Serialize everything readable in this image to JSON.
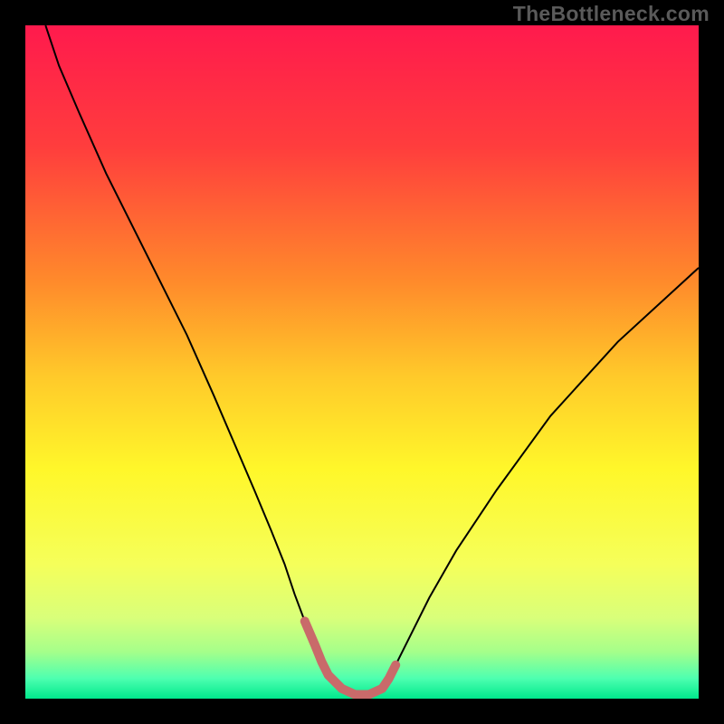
{
  "watermark": "TheBottleneck.com",
  "chart_data": {
    "type": "line",
    "title": "",
    "xlabel": "",
    "ylabel": "",
    "xlim": [
      0,
      100
    ],
    "ylim": [
      0,
      100
    ],
    "background_gradient_stops": [
      {
        "offset": 0.0,
        "color": "#ff1a4d"
      },
      {
        "offset": 0.18,
        "color": "#ff3d3d"
      },
      {
        "offset": 0.38,
        "color": "#ff8a2b"
      },
      {
        "offset": 0.52,
        "color": "#ffc92a"
      },
      {
        "offset": 0.66,
        "color": "#fff72a"
      },
      {
        "offset": 0.8,
        "color": "#f5ff5a"
      },
      {
        "offset": 0.88,
        "color": "#d9ff7a"
      },
      {
        "offset": 0.93,
        "color": "#a6ff8a"
      },
      {
        "offset": 0.97,
        "color": "#4dffb0"
      },
      {
        "offset": 1.0,
        "color": "#00e88c"
      }
    ],
    "series": [
      {
        "name": "bottleneck-curve",
        "stroke": "#000000",
        "stroke_width": 2,
        "x": [
          3,
          5,
          8,
          12,
          16,
          20,
          24,
          28,
          31,
          34,
          36.5,
          38.5,
          40,
          41.5,
          43,
          44,
          45,
          47,
          49,
          51,
          53,
          54,
          55,
          57,
          60,
          64,
          70,
          78,
          88,
          100
        ],
        "y": [
          100,
          94,
          87,
          78,
          70,
          62,
          54,
          45,
          38,
          31,
          25,
          20,
          15.5,
          11.5,
          8,
          5.5,
          3.5,
          1.5,
          0.6,
          0.6,
          1.5,
          3,
          5,
          9,
          15,
          22,
          31,
          42,
          53,
          64
        ]
      },
      {
        "name": "optimal-zone-marker",
        "stroke": "#c96a6a",
        "stroke_width": 10,
        "linecap": "round",
        "x": [
          41.5,
          43,
          44,
          45,
          47,
          49,
          51,
          53,
          54,
          55
        ],
        "y": [
          11.5,
          8,
          5.5,
          3.5,
          1.5,
          0.6,
          0.6,
          1.5,
          3,
          5
        ]
      }
    ]
  }
}
